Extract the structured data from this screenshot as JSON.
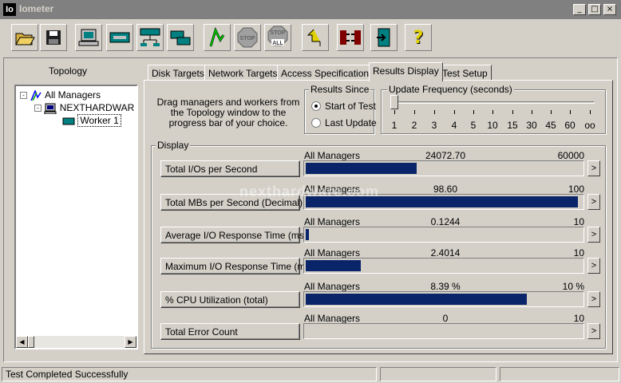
{
  "window": {
    "icon_text": "Io",
    "title": "Iometer",
    "min": "_",
    "max": "□",
    "close": "×"
  },
  "toolbar": {
    "stop_label": "STOP",
    "stop_all_label": "STOP\nALL",
    "help_label": "?"
  },
  "topology": {
    "label": "Topology",
    "tree": {
      "root": "All Managers",
      "manager": "NEXTHARDWAR",
      "worker": "Worker 1"
    }
  },
  "tabs": [
    "Disk Targets",
    "Network Targets",
    "Access Specifications",
    "Results Display",
    "Test Setup"
  ],
  "active_tab": "Results Display",
  "instructions": "Drag managers and workers from the Topology window to the progress bar of your choice.",
  "results_since": {
    "title": "Results Since",
    "options": [
      "Start of Test",
      "Last Update"
    ],
    "selected": "Start of Test"
  },
  "update_frequency": {
    "title": "Update Frequency (seconds)",
    "ticks": [
      "1",
      "2",
      "3",
      "4",
      "5",
      "10",
      "15",
      "30",
      "45",
      "60",
      "oo"
    ]
  },
  "display": {
    "title": "Display",
    "metrics": [
      {
        "label": "Total I/Os per Second",
        "source": "All Managers",
        "value": "24072.70",
        "max": "60000",
        "fraction": 0.401
      },
      {
        "label": "Total MBs per Second (Decimal)",
        "source": "All Managers",
        "value": "98.60",
        "max": "100",
        "fraction": 0.986
      },
      {
        "label": "Average I/O Response Time (ms)",
        "source": "All Managers",
        "value": "0.1244",
        "max": "10",
        "fraction": 0.012
      },
      {
        "label": "Maximum I/O Response Time (ms)",
        "source": "All Managers",
        "value": "2.4014",
        "max": "10",
        "fraction": 0.2
      },
      {
        "label": "% CPU Utilization (total)",
        "source": "All Managers",
        "value": "8.39 %",
        "max": "10 %",
        "fraction": 0.8
      },
      {
        "label": "Total Error Count",
        "source": "All Managers",
        "value": "0",
        "max": "10",
        "fraction": 0
      }
    ],
    "arrow": ">"
  },
  "watermark": "nexthardware.com",
  "status": {
    "message": "Test Completed Successfully"
  },
  "colors": {
    "bar_fill": "#0a246a",
    "titlebar": "#808080",
    "face": "#d4d0c8"
  }
}
